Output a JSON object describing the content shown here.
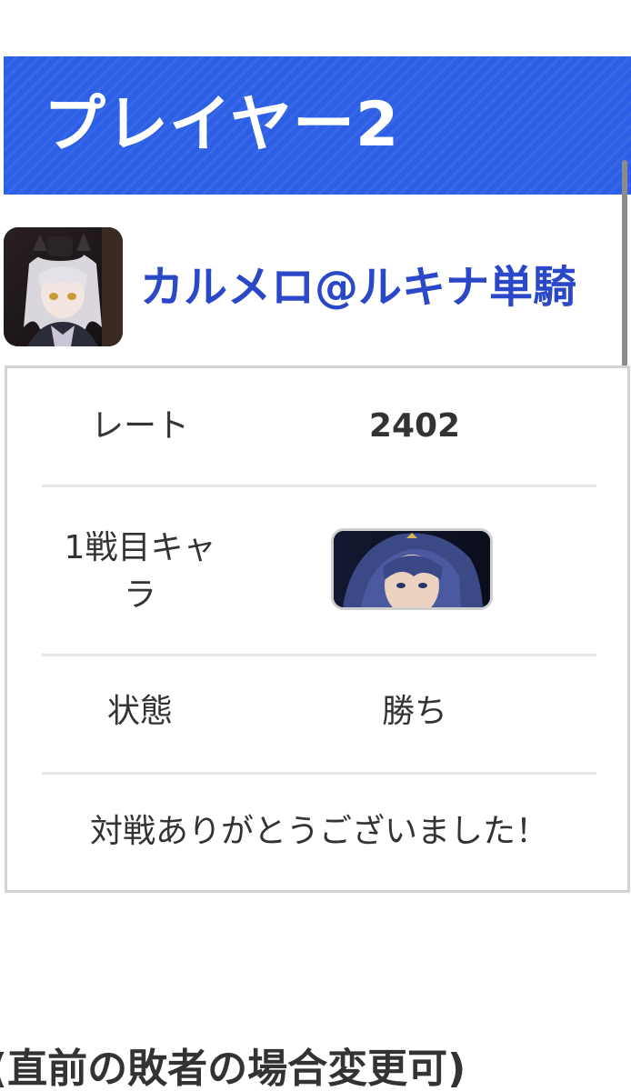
{
  "header": {
    "title": "プレイヤー2",
    "accent_color": "#2d5fe6"
  },
  "player": {
    "name": "カルメロ@ルキナ単騎",
    "name_color": "#2a48c8",
    "avatar_icon": "player-avatar-image"
  },
  "info": {
    "rows": [
      {
        "label": "レート",
        "value": "2402"
      },
      {
        "label": "1戦目キャラ",
        "value_icon": "lucina-character-icon"
      },
      {
        "label": "状態",
        "value": "勝ち"
      }
    ],
    "message": "対戦ありがとうございました！"
  },
  "footer": {
    "partial_text": "(直前の敗者の場合変更可)"
  }
}
